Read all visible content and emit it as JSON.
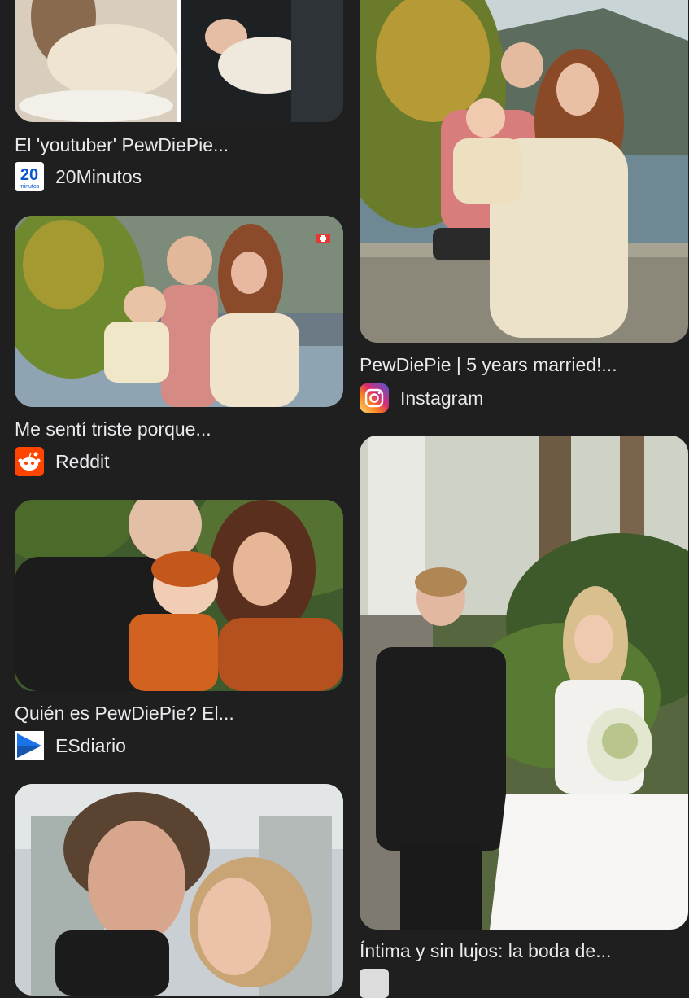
{
  "results": [
    {
      "title": "El 'youtuber' PewDiePie...",
      "source": "20Minutos",
      "icon": "20minutos-icon",
      "icon_text": "20",
      "icon_sub": "minutos",
      "icon_color": "#0b57d0"
    },
    {
      "title": "Me sentí triste porque...",
      "source": "Reddit",
      "icon": "reddit-icon",
      "icon_color": "#ff4500"
    },
    {
      "title": "Quién es PewDiePie? El...",
      "source": "ESdiario",
      "icon": "esdiario-icon",
      "icon_color": "#1a73e8"
    },
    {
      "title": "PewDiePie | 5 years married!...",
      "source": "Instagram",
      "icon": "instagram-icon",
      "icon_color": "#d62976"
    },
    {
      "title": "Íntima y sin lujos: la boda de...",
      "source": "",
      "icon": "source-icon"
    }
  ],
  "colors": {
    "background": "#1f1f1f",
    "text": "#e8eaed"
  }
}
